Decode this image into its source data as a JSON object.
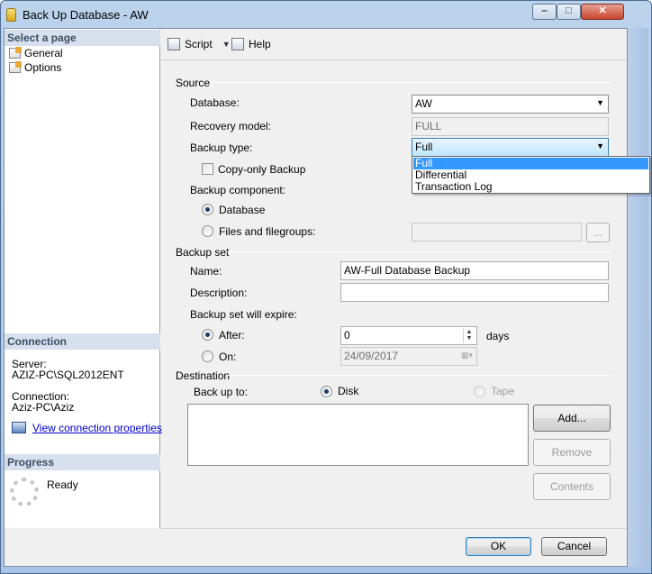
{
  "window": {
    "title": "Back Up Database - AW"
  },
  "left": {
    "select_page": "Select a page",
    "pages": [
      "General",
      "Options"
    ],
    "connection_header": "Connection",
    "server_label": "Server:",
    "server_value": "AZIZ-PC\\SQL2012ENT",
    "connection_label": "Connection:",
    "connection_value": "Aziz-PC\\Aziz",
    "view_link": "View connection properties",
    "progress_header": "Progress",
    "progress_status": "Ready"
  },
  "toolbar": {
    "script": "Script",
    "help": "Help"
  },
  "source": {
    "group": "Source",
    "database_label": "Database:",
    "database_value": "AW",
    "recovery_label": "Recovery model:",
    "recovery_value": "FULL",
    "backup_type_label": "Backup type:",
    "backup_type_value": "Full",
    "backup_type_options": [
      "Full",
      "Differential",
      "Transaction Log"
    ],
    "copy_only": "Copy-only Backup",
    "component_label": "Backup component:",
    "component_database": "Database",
    "component_files": "Files and filegroups:",
    "browse": "..."
  },
  "backup_set": {
    "group": "Backup set",
    "name_label": "Name:",
    "name_value": "AW-Full Database Backup",
    "description_label": "Description:",
    "description_value": "",
    "expire_label": "Backup set will expire:",
    "after_label": "After:",
    "after_value": "0",
    "days": "days",
    "on_label": "On:",
    "on_value": "24/09/2017"
  },
  "destination": {
    "group": "Destination",
    "backup_to_label": "Back up to:",
    "disk": "Disk",
    "tape": "Tape",
    "add": "Add...",
    "remove": "Remove",
    "contents": "Contents"
  },
  "footer": {
    "ok": "OK",
    "cancel": "Cancel"
  }
}
